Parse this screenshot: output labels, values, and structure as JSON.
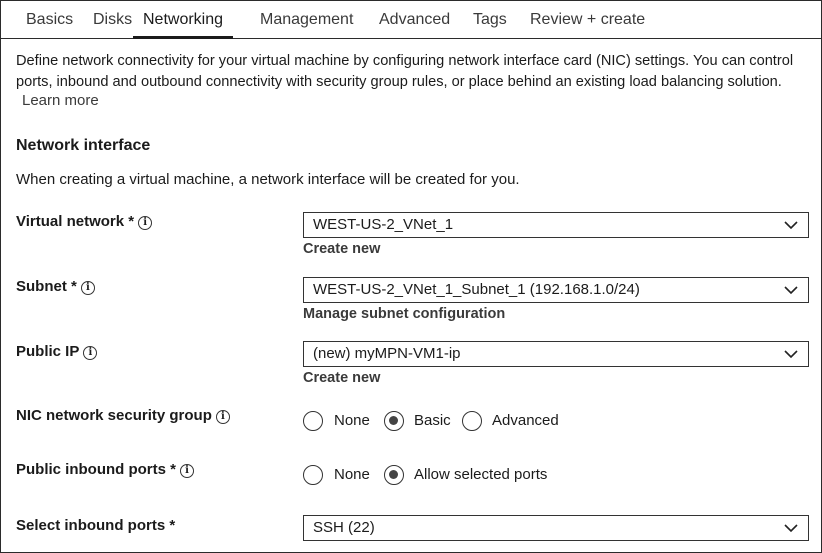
{
  "tabs": [
    "Basics",
    "Disks",
    "Networking",
    "Management",
    "Advanced",
    "Tags",
    "Review + create"
  ],
  "active_tab": "Networking",
  "description": "Define network connectivity for your virtual machine by configuring network interface card (NIC) settings. You can control ports, inbound and outbound connectivity with security group rules, or place behind an existing load balancing solution.",
  "learn_more": "Learn more",
  "section": {
    "title": "Network interface",
    "subtitle": "When creating a virtual machine, a network interface will be created for you."
  },
  "fields": {
    "virtual_network": {
      "label": "Virtual network *",
      "value": "WEST-US-2_VNet_1",
      "link": "Create new"
    },
    "subnet": {
      "label": "Subnet *",
      "value": "WEST-US-2_VNet_1_Subnet_1 (192.168.1.0/24)",
      "link": "Manage subnet configuration"
    },
    "public_ip": {
      "label": "Public IP",
      "value": "(new) myMPN-VM1-ip",
      "link": "Create new"
    },
    "nic_nsg": {
      "label": "NIC network security group",
      "options": [
        "None",
        "Basic",
        "Advanced"
      ],
      "selected": "Basic"
    },
    "public_inbound_ports": {
      "label": "Public inbound ports *",
      "options": [
        "None",
        "Allow selected ports"
      ],
      "selected": "Allow selected ports"
    },
    "select_inbound_ports": {
      "label": "Select inbound ports *",
      "value": "SSH (22)"
    }
  },
  "icons": {
    "info": "info-circle-icon",
    "dropdown": "chevron-down-icon"
  }
}
